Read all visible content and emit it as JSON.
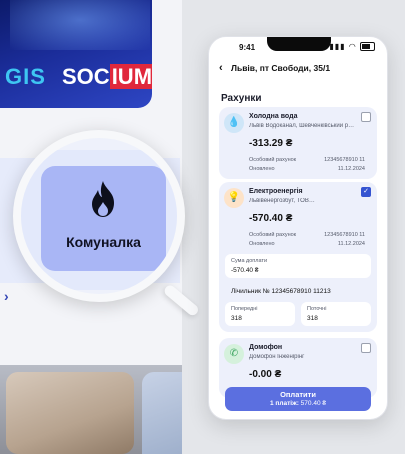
{
  "left_panel": {
    "banner_brand_1": "GIS",
    "banner_brand_2_prefix": "SOC",
    "banner_brand_2_highlight": "IUM"
  },
  "magnifier": {
    "tile_label": "Комуналка",
    "tile_icon": "flame-icon"
  },
  "phone": {
    "status": {
      "time": "9:41",
      "signal_icon": "signal-icon",
      "wifi_icon": "wifi-icon",
      "battery_icon": "battery-icon"
    },
    "nav": {
      "back_icon": "chevron-left-icon",
      "title": "Львів, пт Свободи, 35/1"
    },
    "section_title": "Рахунки",
    "bills": [
      {
        "name": "Холодна вода",
        "provider": "Львів Водоканал, Шевченківський р…",
        "amount": "-313.29 ₴",
        "account_label": "Особовий рахунок",
        "account_number": "12345678910 11",
        "updated_label": "Оновлено",
        "updated_date": "11.12.2024",
        "checked": false,
        "icon": "water-drop-icon",
        "icon_color": "#cfe6f8"
      },
      {
        "name": "Електроенергія",
        "provider": "Львівенергозбут, ТОВ…",
        "amount": "-570.40 ₴",
        "account_label": "Особовий рахунок",
        "account_number": "12345678910 11",
        "updated_label": "Оновлено",
        "updated_date": "11.12.2024",
        "checked": true,
        "icon": "lightbulb-icon",
        "icon_color": "#fde3c8",
        "payment_label": "Сума доплати",
        "payment_value": "-570.40 ₴",
        "meter_label": "Лічильник № 12345678910 11213",
        "previous_label": "Попередні",
        "previous_value": "318",
        "current_label": "Поточні",
        "current_value": "318"
      },
      {
        "name": "Домофон",
        "provider": "Домофон Інженірінг",
        "amount": "-0.00 ₴",
        "checked": false,
        "icon": "phone-icon",
        "icon_color": "#d5f1dc"
      }
    ],
    "pay_button": {
      "label": "Оплатити",
      "summary_prefix": "1 платіж:",
      "summary_amount": "570.40 ₴"
    }
  },
  "colors": {
    "accent": "#5b6fe0",
    "tile": "#a9b6f5",
    "banner": "#1b2d9a"
  }
}
